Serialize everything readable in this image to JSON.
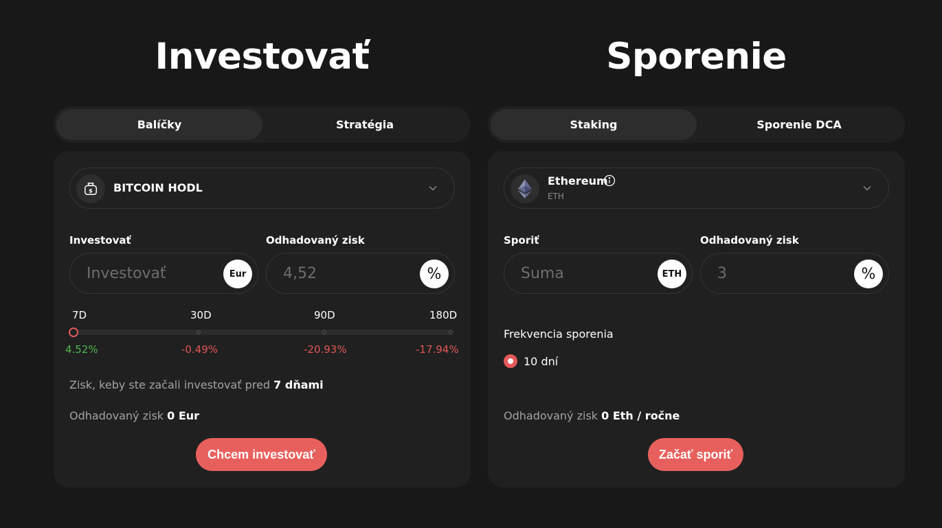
{
  "invest": {
    "title": "Investovať",
    "tabs": [
      {
        "label": "Balíčky",
        "active": true
      },
      {
        "label": "Stratégia",
        "active": false
      }
    ],
    "package": {
      "name": "BITCOIN HODL",
      "icon": "money-bag-icon"
    },
    "amount": {
      "label": "Investovať",
      "placeholder": "Investovať",
      "suffix": "Eur"
    },
    "profit": {
      "label": "Odhadovaný zisk",
      "placeholder": "4,52",
      "suffix": "%"
    },
    "periods": [
      {
        "label": "7D",
        "value": "4.52%",
        "trend": "positive",
        "selected": true
      },
      {
        "label": "30D",
        "value": "-0.49%",
        "trend": "negative",
        "selected": false
      },
      {
        "label": "90D",
        "value": "-20.93%",
        "trend": "negative",
        "selected": false
      },
      {
        "label": "180D",
        "value": "-17.94%",
        "trend": "negative",
        "selected": false
      }
    ],
    "note_prefix": "Zisk, keby ste začali investovať pred ",
    "note_value": "7 dňami",
    "estimate_prefix": "Odhadovaný zisk ",
    "estimate_value": "0 Eur",
    "button": "Chcem investovať"
  },
  "saving": {
    "title": "Sporenie",
    "tabs": [
      {
        "label": "Staking",
        "active": true
      },
      {
        "label": "Sporenie DCA",
        "active": false
      }
    ],
    "asset": {
      "name": "Ethereum",
      "ticker": "ETH",
      "icon": "ethereum-icon"
    },
    "amount": {
      "label": "Sporiť",
      "placeholder": "Suma",
      "suffix": "ETH"
    },
    "profit": {
      "label": "Odhadovaný zisk",
      "placeholder": "3",
      "suffix": "%"
    },
    "frequency_label": "Frekvencia sporenia",
    "frequency_option": "10 dní",
    "estimate_prefix": "Odhadovaný zisk ",
    "estimate_value": "0 Eth / ročne",
    "button": "Začať sporiť"
  },
  "colors": {
    "accent": "#e8605d",
    "positive": "#4fb84f",
    "negative": "#e25555",
    "background": "#181818",
    "card": "#202020"
  }
}
